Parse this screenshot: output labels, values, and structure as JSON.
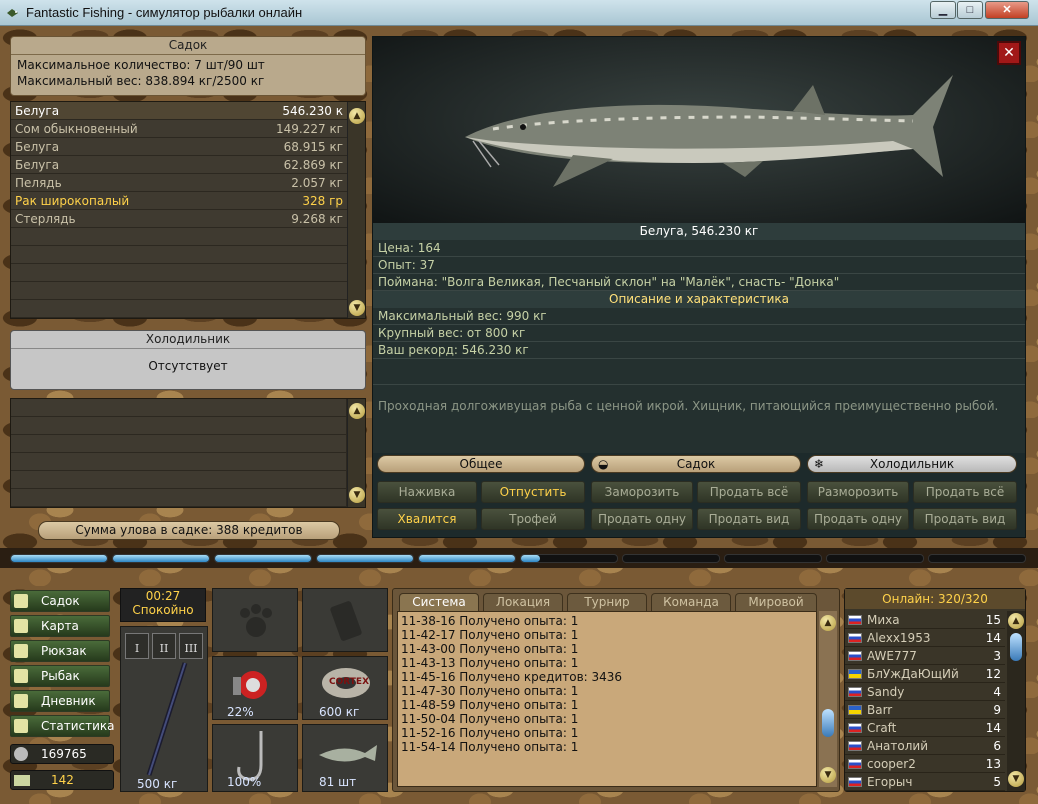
{
  "window": {
    "title": "Fantastic Fishing - симулятор рыбалки онлайн",
    "min": "▁",
    "max": "□",
    "close": "✕"
  },
  "keepnet": {
    "title": "Садок",
    "max_count": "Максимальное количество: 7 шт/90 шт",
    "max_weight": "Максимальный вес: 838.894 кг/2500 кг",
    "items": [
      {
        "name": "Белуга",
        "value": "546.230 к"
      },
      {
        "name": "Сом обыкновенный",
        "value": "149.227 кг"
      },
      {
        "name": "Белуга",
        "value": "68.915 кг"
      },
      {
        "name": "Белуга",
        "value": "62.869 кг"
      },
      {
        "name": "Пелядь",
        "value": "2.057 кг"
      },
      {
        "name": "Рак широкопалый",
        "value": "328 гр"
      },
      {
        "name": "Стерлядь",
        "value": "9.268 кг"
      }
    ],
    "sum": "Сумма улова в садке: 388 кредитов"
  },
  "fridge": {
    "title": "Холодильник",
    "status": "Отсутствует"
  },
  "fish": {
    "caption": "Белуга, 546.230 кг",
    "price": "Цена: 164",
    "exp": "Опыт: 37",
    "caught": "Поймана: \"Волга Великая, Песчаный склон\" на \"Малёк\", снасть- \"Донка\"",
    "desc_title": "Описание и характеристика",
    "max_w": "Максимальный вес: 990 кг",
    "big_w": "Крупный вес: от 800 кг",
    "record": "Ваш рекорд: 546.230 кг",
    "desc": "Проходная долгоживущая рыба с ценной икрой. Хищник, питающийся преимущественно рыбой."
  },
  "tabs": {
    "general": "Общее",
    "keepnet": "Садок",
    "fridge": "Холодильник"
  },
  "actions": {
    "bait": "Наживка",
    "release": "Отпустить",
    "freeze": "Заморозить",
    "sell_all": "Продать всё",
    "unfreeze": "Разморозить",
    "sell_all2": "Продать всё",
    "boast": "Хвалится",
    "trophy": "Трофей",
    "sell_one": "Продать одну",
    "sell_kind": "Продать вид",
    "sell_one2": "Продать одну",
    "sell_kind2": "Продать вид"
  },
  "progress": [
    1,
    1,
    1,
    1,
    1,
    0.2,
    0,
    0,
    0,
    0
  ],
  "nav": [
    "Садок",
    "Карта",
    "Рюкзак",
    "Рыбак",
    "Дневник",
    "Статистика"
  ],
  "money": "169765",
  "gold": "142",
  "clock": {
    "time": "00:27",
    "state": "Спокойно"
  },
  "rod_slots": [
    "I",
    "II",
    "III"
  ],
  "gear": {
    "rod_weight": "500 кг",
    "reel_pct": "22%",
    "line": "600 кг",
    "hook_pct": "100%",
    "bait_count": "81 шт",
    "line_brand": "CORTEX"
  },
  "chat": {
    "tabs": [
      "Система",
      "Локация",
      "Турнир",
      "Команда",
      "Мировой"
    ],
    "lines": [
      "11-38-16 Получено опыта: 1",
      "11-42-17 Получено опыта: 1",
      "11-43-00 Получено опыта: 1",
      "11-43-13 Получено опыта: 1",
      "11-45-16 Получено кредитов: 3436",
      "11-47-30 Получено опыта: 1",
      "11-48-59 Получено опыта: 1",
      "11-50-04 Получено опыта: 1",
      "11-52-16 Получено опыта: 1",
      "11-54-14 Получено опыта: 1"
    ]
  },
  "online": {
    "title": "Онлайн: 320/320",
    "users": [
      {
        "name": "Миха",
        "lvl": "15",
        "flag": "ru"
      },
      {
        "name": "Alexx1953",
        "lvl": "14",
        "flag": "ru"
      },
      {
        "name": "AWE777",
        "lvl": "3",
        "flag": "ru"
      },
      {
        "name": "БлУжДаЮщИй",
        "lvl": "12",
        "flag": "ua"
      },
      {
        "name": "Sandy",
        "lvl": "4",
        "flag": "ru"
      },
      {
        "name": "Barr",
        "lvl": "9",
        "flag": "ua"
      },
      {
        "name": "Craft",
        "lvl": "14",
        "flag": "ru"
      },
      {
        "name": "Анатолий",
        "lvl": "6",
        "flag": "ru"
      },
      {
        "name": "cooper2",
        "lvl": "13",
        "flag": "ru"
      },
      {
        "name": "Егорыч",
        "lvl": "5",
        "flag": "ru"
      }
    ]
  },
  "colors": {
    "accent": "#ffd24a",
    "flag_ru": "#ffffff",
    "flag_ua": "#f5d400"
  }
}
